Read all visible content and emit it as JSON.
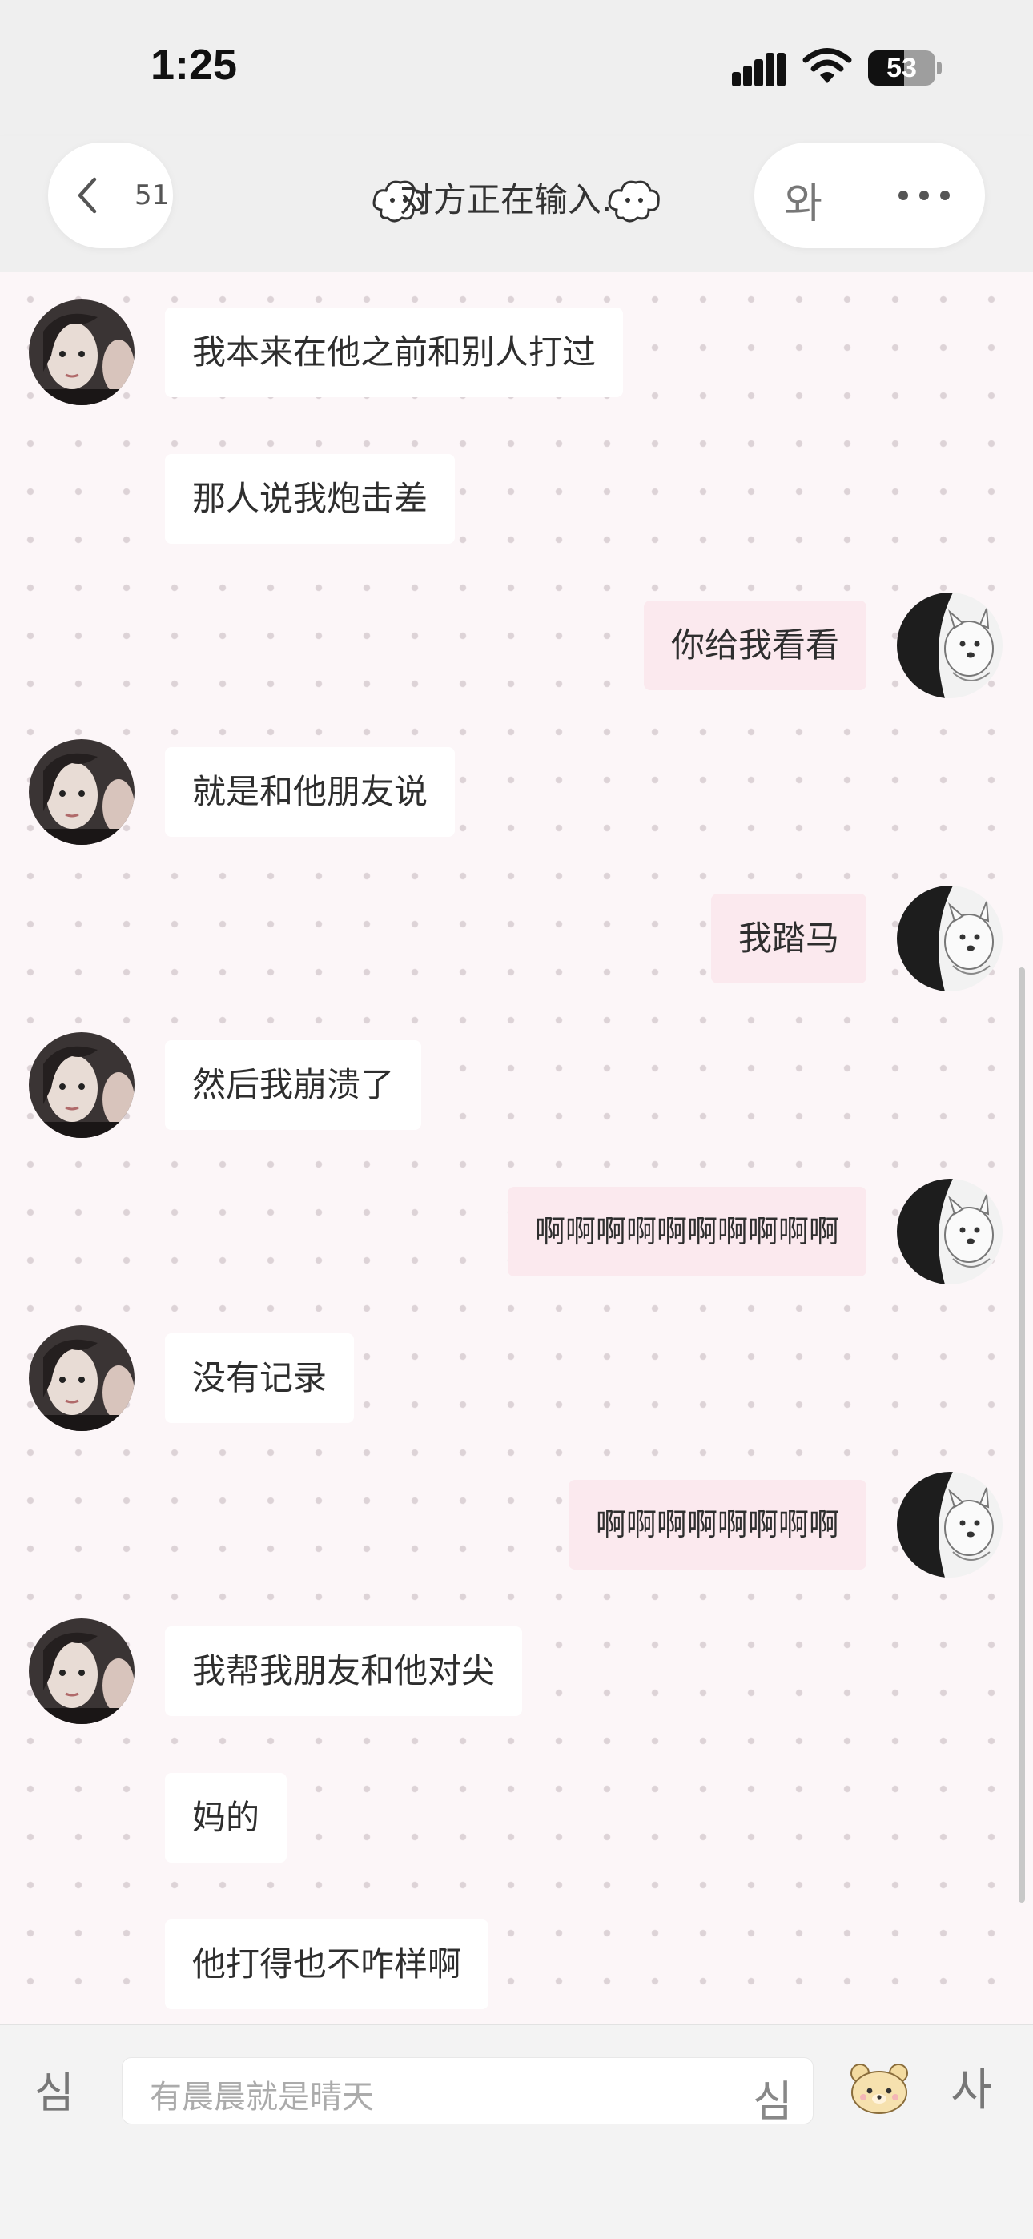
{
  "status_bar": {
    "time": "1:25",
    "battery": "53",
    "battery_level": 0.53
  },
  "nav": {
    "back_count": "51",
    "title": "对方正在输入...",
    "right_label": "와"
  },
  "messages": [
    {
      "side": "left",
      "text": "我本来在他之前和别人打过",
      "avatar": true
    },
    {
      "side": "left",
      "text": "那人说我炮击差",
      "avatar": false
    },
    {
      "side": "right",
      "text": "你给我看看",
      "avatar": true
    },
    {
      "side": "left",
      "text": "就是和他朋友说",
      "avatar": true
    },
    {
      "side": "right",
      "text": "我踏马",
      "avatar": true
    },
    {
      "side": "left",
      "text": "然后我崩溃了",
      "avatar": true
    },
    {
      "side": "right",
      "text": "啊啊啊啊啊啊啊啊啊啊",
      "avatar": true
    },
    {
      "side": "left",
      "text": "没有记录",
      "avatar": true
    },
    {
      "side": "right",
      "text": "啊啊啊啊啊啊啊啊",
      "avatar": true
    },
    {
      "side": "left",
      "text": "我帮我朋友和他对尖",
      "avatar": true
    },
    {
      "side": "left",
      "text": "妈的",
      "avatar": false
    },
    {
      "side": "left",
      "text": "他打得也不咋样啊",
      "avatar": false
    }
  ],
  "input_bar": {
    "left_label": "심",
    "placeholder": "有晨晨就是晴天",
    "inline_label": "심",
    "right_label": "사"
  },
  "colors": {
    "chat_bg": "#fcf6f8",
    "left_bubble": "#ffffff",
    "right_bubble": "#fbe9ee",
    "bar_bg": "#efefef"
  }
}
